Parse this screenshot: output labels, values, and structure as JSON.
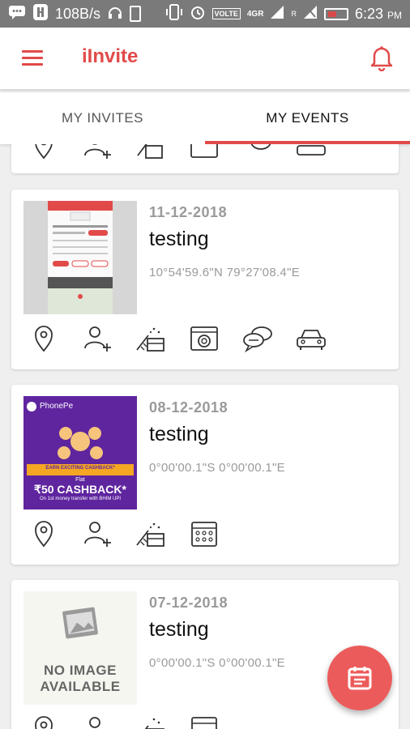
{
  "status_bar": {
    "net_speed": "108B/s",
    "volte": "VOLTE",
    "network": "4GR",
    "roaming": "R",
    "time": "6:23",
    "ampm": "PM"
  },
  "app": {
    "title": "iInvite"
  },
  "tabs": [
    {
      "label": "MY INVITES"
    },
    {
      "label": "MY EVENTS"
    }
  ],
  "events": [
    {
      "date": "11-12-2018",
      "name": "testing",
      "coords": "10°54'59.6\"N 79°27'08.4\"E"
    },
    {
      "date": "08-12-2018",
      "name": "testing",
      "coords": "0°00'00.1\"S 0°00'00.1\"E",
      "thumb": {
        "brand": "PhonePe",
        "banner": "EARN EXCITING CASHBACK*",
        "flat": "Flat",
        "cashback": "₹50 CASHBACK*",
        "sub": "On 1st money transfer with BHIM UPI"
      }
    },
    {
      "date": "07-12-2018",
      "name": "testing",
      "coords": "0°00'00.1\"S 0°00'00.1\"E",
      "thumb": {
        "line1": "NO IMAGE",
        "line2": "AVAILABLE"
      }
    }
  ],
  "colors": {
    "accent": "#e24a4a",
    "fab": "#ec5b5b",
    "status_bar": "#7a7a7a",
    "phonepe_purple": "#5f259f"
  },
  "icons": [
    "location-icon",
    "add-guest-icon",
    "gift-icon",
    "photo-gallery-icon",
    "chat-icon",
    "car-icon",
    "calendar-icon"
  ]
}
